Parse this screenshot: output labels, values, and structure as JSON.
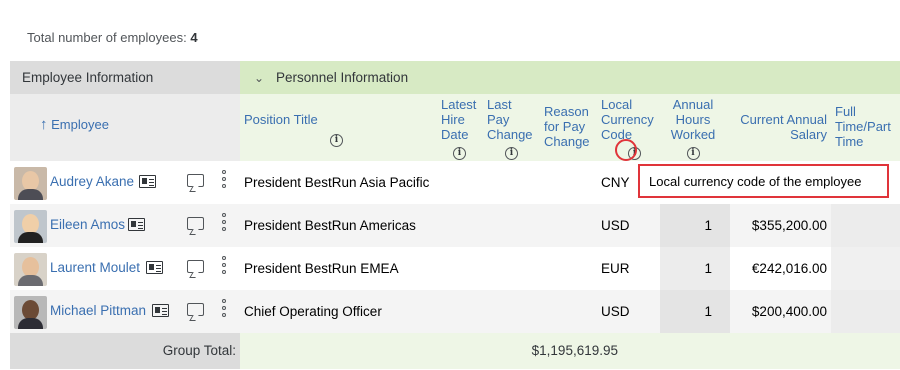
{
  "summary": {
    "label": "Total number of employees:",
    "count": "4"
  },
  "groups": {
    "employee": "Employee Information",
    "personnel": "Personnel Information",
    "chevron": "chevron-down-icon"
  },
  "columns": {
    "employee": "Employee",
    "position_title": "Position Title",
    "latest_hire_date": [
      "Latest",
      "Hire",
      "Date"
    ],
    "last_pay_change": [
      "Last",
      "Pay",
      "Change"
    ],
    "reason_for_pay_change": [
      "Reason",
      "for Pay",
      "Change"
    ],
    "local_currency_code": [
      "Local",
      "Currency",
      "Code"
    ],
    "annual_hours_worked": [
      "Annual",
      "Hours",
      "Worked"
    ],
    "current_annual_salary": [
      "Current Annual",
      "Salary"
    ],
    "full_part_time": [
      "Full",
      "Time/Part",
      "Time"
    ],
    "sort_icon": "arrow-up-icon",
    "info_icon": "info-icon"
  },
  "rows": [
    {
      "name": "Audrey Akane",
      "position": "President BestRun Asia Pacific",
      "currency": "CNY",
      "hours": "",
      "salary": ""
    },
    {
      "name": "Eileen Amos",
      "position": "President BestRun Americas",
      "currency": "USD",
      "hours": "1",
      "salary": "$355,200.00"
    },
    {
      "name": "Laurent Moulet",
      "position": "President BestRun EMEA",
      "currency": "EUR",
      "hours": "1",
      "salary": "€242,016.00"
    },
    {
      "name": "Michael Pittman",
      "position": "Chief Operating Officer",
      "currency": "USD",
      "hours": "1",
      "salary": "$200,400.00"
    }
  ],
  "tooltip": "Local currency code of the employee",
  "group_total": {
    "label": "Group Total:",
    "value": "$1,195,619.95"
  },
  "colors": {
    "link": "#3a6fb0",
    "highlight": "#e0343a",
    "group_green": "#d7eac4"
  }
}
